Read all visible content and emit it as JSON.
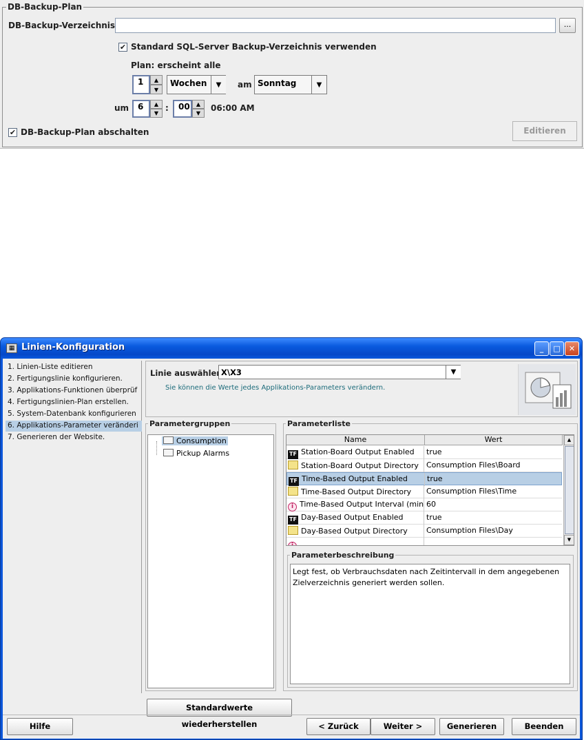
{
  "backup_plan": {
    "title": "DB-Backup-Plan",
    "dir_label": "DB-Backup-Verzeichnis",
    "dir_value": "",
    "browse_label": "...",
    "use_std_dir_label": "Standard SQL-Server Backup-Verzeichnis verwenden",
    "use_std_dir_checked": true,
    "plan_label": "Plan: erscheint alle",
    "interval_value": "1",
    "unit_value": "Wochen",
    "am_label": "am",
    "day_value": "Sonntag",
    "um_label": "um",
    "hour_value": "6",
    "colon": ":",
    "minute_value": "00",
    "time_display": "06:00 AM",
    "disable_label": "DB-Backup-Plan abschalten",
    "disable_checked": true,
    "edit_button": "Editieren",
    "check_mark": "✔"
  },
  "window": {
    "title": "Linien-Konfiguration",
    "steps": [
      "1. Linien-Liste editieren",
      "2. Fertigungslinie konfigurieren.",
      "3. Applikations-Funktionen überprüf",
      "4. Fertigungslinien-Plan erstellen.",
      "5. System-Datenbank konfigurieren",
      "6. Applikations-Parameter veränderi",
      "7. Generieren der Website."
    ],
    "selected_step": 5,
    "line_select_label": "Linie auswählen:",
    "line_value": "X\\X3",
    "info_text": "Sie können die Werte jedes Applikations-Parameters verändern.",
    "param_groups": {
      "title": "Parametergruppen",
      "items": [
        "Consumption",
        "Pickup Alarms"
      ]
    },
    "param_list": {
      "title": "Parameterliste",
      "col_name": "Name",
      "col_value": "Wert",
      "rows": [
        {
          "name": "Station-Board Output Enabled",
          "value": "true",
          "icon": "tf-icon"
        },
        {
          "name": "Station-Board Output Directory",
          "value": "Consumption Files\\Board",
          "icon": "folder-icon"
        },
        {
          "name": "Time-Based Output Enabled",
          "value": "true",
          "icon": "tf-icon"
        },
        {
          "name": "Time-Based Output Directory",
          "value": "Consumption Files\\Time",
          "icon": "folder-icon"
        },
        {
          "name": "Time-Based Output Interval (min)",
          "value": "60",
          "icon": "info-icon"
        },
        {
          "name": "Day-Based Output Enabled",
          "value": "true",
          "icon": "tf-icon"
        },
        {
          "name": "Day-Based Output Directory",
          "value": "Consumption Files\\Day",
          "icon": "folder-icon"
        }
      ],
      "selected_row": 2
    },
    "param_desc": {
      "title": "Parameterbeschreibung",
      "text": "Legt fest, ob Verbrauchsdaten nach Zeitintervall in dem angegebenen Zielverzeichnis generiert werden sollen."
    },
    "restore_defaults": "Standardwerte wiederherstellen",
    "buttons": {
      "help": "Hilfe",
      "back": "< Zurück",
      "next": "Weiter >",
      "generate": "Generieren",
      "exit": "Beenden"
    },
    "colors": {
      "titlebar": "#0a5ade",
      "selection": "#b8cfe5",
      "info_text": "#1b6b7a"
    }
  }
}
